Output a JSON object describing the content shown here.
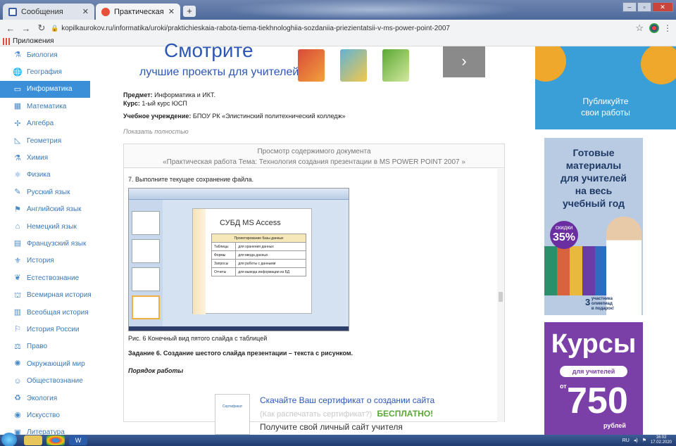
{
  "browser": {
    "tabs": [
      {
        "label": "Сообщения",
        "active": false
      },
      {
        "label": "Практическая работа Тема: Те",
        "active": true
      }
    ],
    "url": "kopilkaurokov.ru/informatika/uroki/praktichieskaia-rabota-tiema-tiekhnologhiia-sozdaniia-priezientatsii-v-ms-power-point-2007",
    "bookmarks_label": "Приложения"
  },
  "sidebar": {
    "items": [
      {
        "label": "Биология",
        "icon": "microscope-icon",
        "glyph": "⚗"
      },
      {
        "label": "География",
        "icon": "globe-icon",
        "glyph": "🌐"
      },
      {
        "label": "Информатика",
        "icon": "monitor-icon",
        "glyph": "▭",
        "active": true
      },
      {
        "label": "Математика",
        "icon": "calculator-icon",
        "glyph": "▦"
      },
      {
        "label": "Алгебра",
        "icon": "function-icon",
        "glyph": "✢"
      },
      {
        "label": "Геометрия",
        "icon": "ruler-icon",
        "glyph": "◺"
      },
      {
        "label": "Химия",
        "icon": "flask-icon",
        "glyph": "⚗"
      },
      {
        "label": "Физика",
        "icon": "atom-icon",
        "glyph": "⚛"
      },
      {
        "label": "Русский язык",
        "icon": "pen-icon",
        "glyph": "✎"
      },
      {
        "label": "Английский язык",
        "icon": "flag-icon",
        "glyph": "⚑"
      },
      {
        "label": "Немецкий язык",
        "icon": "building-icon",
        "glyph": "⌂"
      },
      {
        "label": "Французский язык",
        "icon": "book-icon",
        "glyph": "▤"
      },
      {
        "label": "История",
        "icon": "helmet-icon",
        "glyph": "⚜"
      },
      {
        "label": "Естествознание",
        "icon": "leaf-icon",
        "glyph": "❦"
      },
      {
        "label": "Всемирная история",
        "icon": "tower-icon",
        "glyph": "⛫"
      },
      {
        "label": "Всеобщая история",
        "icon": "scroll-icon",
        "glyph": "▥"
      },
      {
        "label": "История России",
        "icon": "russia-icon",
        "glyph": "⚐"
      },
      {
        "label": "Право",
        "icon": "scales-icon",
        "glyph": "⚖"
      },
      {
        "label": "Окружающий мир",
        "icon": "sun-icon",
        "glyph": "✺"
      },
      {
        "label": "Обществознание",
        "icon": "people-icon",
        "glyph": "☺"
      },
      {
        "label": "Экология",
        "icon": "eco-icon",
        "glyph": "♻"
      },
      {
        "label": "Искусство",
        "icon": "palette-icon",
        "glyph": "◉"
      },
      {
        "label": "Литература",
        "icon": "book-open-icon",
        "glyph": "▣"
      }
    ]
  },
  "ad_top": {
    "headline": "Смотрите",
    "subline": "лучшие проекты для учителей"
  },
  "document": {
    "subject_label": "Предмет:",
    "subject_value": "Информатика и ИКТ.",
    "course_label": "Курс:",
    "course_value": "1-ый курс  ЮСП",
    "institution_label": "Учебное учреждение:",
    "institution_value": "БПОУ РК «Элистинский политехнический колледж»",
    "show_more": "Показать полностью",
    "viewer_title": "Просмотр содержимого документа",
    "viewer_subtitle": "«Практическая работа Тема: Технология создания презентации в MS POWER POINT 2007 »",
    "step": "7. Выполните текущее сохранение файла.",
    "slide": {
      "title": "СУБД MS Access",
      "header": "Проектирование базы данных",
      "rows": [
        [
          "Таблицы",
          "для хранения данных"
        ],
        [
          "Формы",
          "для ввода данных"
        ],
        [
          "Запросы",
          "для работы с данными"
        ],
        [
          "Отчеты",
          "для вывода информации из БД"
        ]
      ]
    },
    "figure_caption": "Рис. 6 Конечный вид пятого слайда с таблицей",
    "task": "Задание 6. Создание шестого слайда презентации – текста с рисунком.",
    "order": "Порядок работы"
  },
  "certificate": {
    "image_text": "Сертификат",
    "line1": "Скачайте Ваш сертификат о создании сайта",
    "line2": "(Как распечатать сертификат?)",
    "free": "БЕСПЛАТНО!",
    "line3": "Получите свой личный сайт учителя"
  },
  "banners": {
    "publish": "Публикуйте\nсвои работы",
    "materials": "Готовые\nматериалы\nдля учителей\nна весь\nучебный год",
    "discount_word": "скидки",
    "discount_value": "35%",
    "olymp_number": "3",
    "olymp_text": "участника\nолимпиад\nв подарок!",
    "courses": "Курсы",
    "courses_pill": "для учителей",
    "from": "от",
    "price": "750",
    "currency": "рублей"
  },
  "taskbar": {
    "lang": "RU",
    "time": "16:02",
    "date": "17.02.2020"
  },
  "colors": {
    "accent": "#3b8fd9",
    "link": "#2c57b6",
    "free": "#5aa832"
  }
}
